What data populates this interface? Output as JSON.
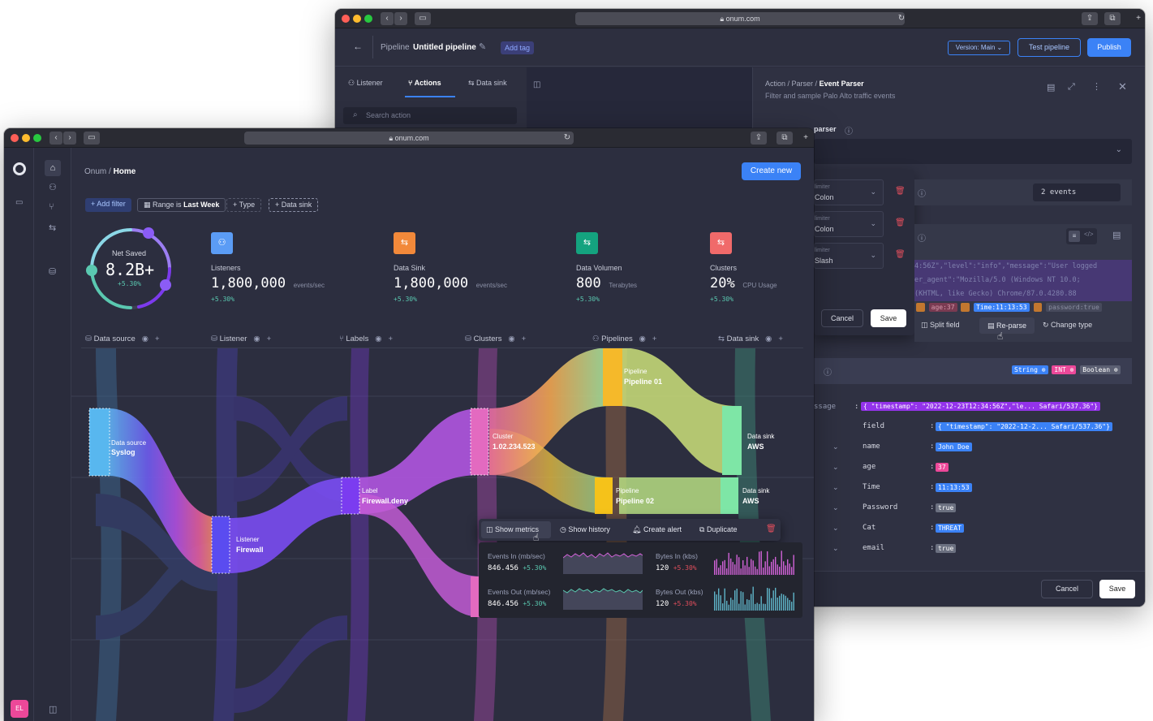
{
  "back_window": {
    "url": "onum.com",
    "breadcrumb_prefix": "Pipeline",
    "pipeline_name": "Untitled pipeline",
    "add_tag": "Add tag",
    "version": "Version: Main",
    "test_btn": "Test pipeline",
    "publish_btn": "Publish",
    "tabs": [
      "Listener",
      "Actions",
      "Data sink"
    ],
    "search_placeholder": "Search action",
    "action_breadcrumb": {
      "a": "Action",
      "b": "Parser",
      "c": "Event Parser"
    },
    "action_desc": "Filter and sample Palo Alto traffic events",
    "field_label": "parser",
    "delimiters": [
      {
        "label": "limiter",
        "value": "Colon"
      },
      {
        "label": "limiter",
        "value": "Colon"
      },
      {
        "label": "limiter",
        "value": "Slash"
      }
    ],
    "events_count": "2 events",
    "log_lines": [
      "4:56Z\",\"level\":\"info\",\"message\":\"User logged",
      "er_agent\":\"Mozilla/5.0 (Windows NT 10.0;",
      "(KHTML, like Gecko) Chrome/87.0.4280.88"
    ],
    "log_tags": [
      "age:37",
      "Time:11:13:53",
      "password:true"
    ],
    "cancel": "Cancel",
    "save": "Save",
    "split_field": "Split field",
    "reparse": "Re-parse",
    "change_type": "Change type",
    "type_tags": [
      "String",
      "INT",
      "Boolean"
    ],
    "message_key": "ssage",
    "message_value": "{ \"timestamp\": \"2022-12-23T12:34:56Z\",\"le... Safari/537.36\"}",
    "fields": [
      {
        "name": "field",
        "value": "{ \"timestamp\": \"2022-12-2... Safari/537.36\"}",
        "color": "#3b82f6"
      },
      {
        "name": "name",
        "value": "John Doe",
        "color": "#3b82f6"
      },
      {
        "name": "age",
        "value": "37",
        "color": "#ec4899"
      },
      {
        "name": "Time",
        "value": "11:13:53",
        "color": "#3b82f6"
      },
      {
        "name": "Password",
        "value": "true",
        "color": "#6b7080"
      },
      {
        "name": "Cat",
        "value": "THREAT",
        "color": "#3b82f6"
      },
      {
        "name": "email",
        "value": "true",
        "color": "#6b7080"
      }
    ],
    "left_snips": [
      "n",
      "",
      "n"
    ],
    "footer_cancel": "Cancel",
    "footer_save": "Save"
  },
  "front_window": {
    "url": "onum.com",
    "breadcrumb": {
      "root": "Onum",
      "current": "Home"
    },
    "create_new": "Create new",
    "filters": {
      "add": "+ Add filter",
      "range_prefix": "Range is",
      "range_value": "Last Week",
      "type": "+ Type",
      "data_sink": "+ Data sink"
    },
    "net_saved": {
      "label": "Net Saved",
      "value": "8.2B+",
      "delta": "+5.30%"
    },
    "kpis": [
      {
        "label": "Listeners",
        "value": "1,800,000",
        "unit": "events/sec",
        "delta": "+5.30%",
        "color": "#5b9cf5",
        "icon": "sitemap-icon"
      },
      {
        "label": "Data Sink",
        "value": "1,800,000",
        "unit": "events/sec",
        "delta": "+5.30%",
        "color": "#f2893a",
        "icon": "sink-icon"
      },
      {
        "label": "Data Volumen",
        "value": "800",
        "unit": "Terabytes",
        "delta": "+5.30%",
        "color": "#14a37f",
        "icon": "sink-icon"
      },
      {
        "label": "Clusters",
        "value": "20%",
        "unit": "CPU Usage",
        "delta": "+5.30%",
        "color": "#f06a6a",
        "icon": "sink-icon"
      }
    ],
    "columns": [
      "Data source",
      "Listener",
      "Labels",
      "Clusters",
      "Pipelines",
      "Data sink"
    ],
    "nodes": {
      "source": {
        "type": "Data source",
        "name": "Syslog"
      },
      "listener": {
        "type": "Listener",
        "name": "Firewall"
      },
      "label": {
        "type": "Label",
        "name": "Firewall.deny"
      },
      "cluster": {
        "type": "Cluster",
        "name": "1.02.234.523"
      },
      "pipeline1": {
        "type": "Pipeline",
        "name": "Pipeline 01"
      },
      "pipeline2": {
        "type": "Pipeline",
        "name": "Pipeline 02"
      },
      "sink1": {
        "type": "Data sink",
        "name": "AWS"
      },
      "sink2": {
        "type": "Data sink",
        "name": "AWS"
      }
    },
    "context_menu": [
      "Show metrics",
      "Show history",
      "Create alert",
      "Duplicate"
    ],
    "metrics": [
      {
        "label": "Events In (mb/sec)",
        "value": "846.456",
        "delta": "+5.30%"
      },
      {
        "label": "Bytes In (kbs)",
        "value": "120",
        "delta": "+5.30%"
      },
      {
        "label": "Events Out (mb/sec)",
        "value": "846.456",
        "delta": "+5.30%"
      },
      {
        "label": "Bytes Out (kbs)",
        "value": "120",
        "delta": "+5.30%"
      }
    ],
    "avatar": "EL"
  }
}
